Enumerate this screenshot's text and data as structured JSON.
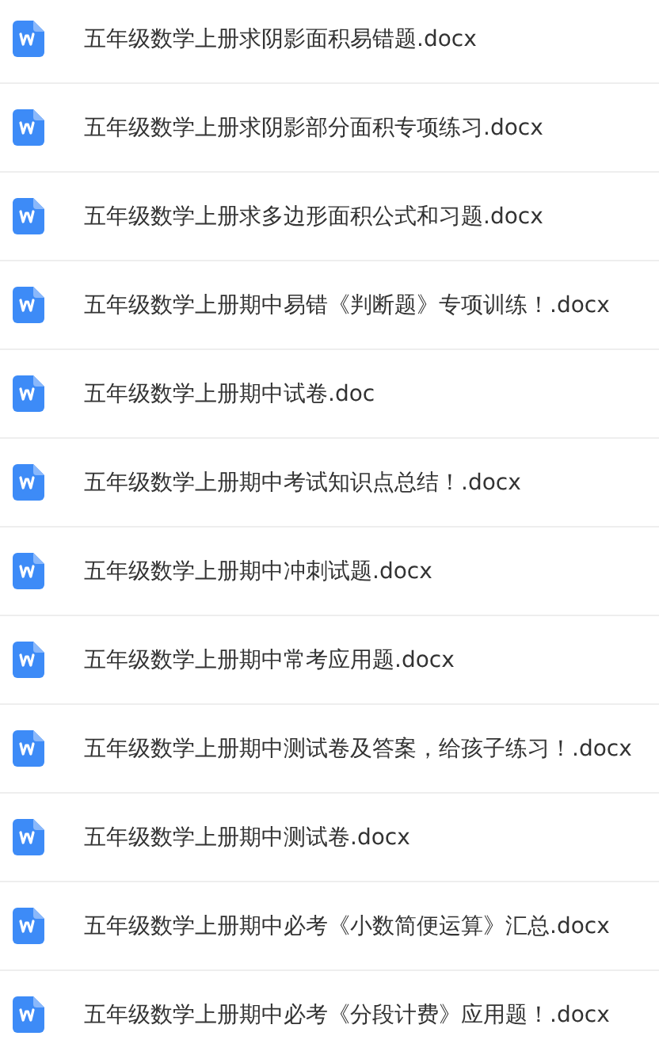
{
  "files": [
    {
      "name": "五年级数学上册求阴影面积易错题.docx",
      "kind": "word"
    },
    {
      "name": "五年级数学上册求阴影部分面积专项练习.docx",
      "kind": "word"
    },
    {
      "name": "五年级数学上册求多边形面积公式和习题.docx",
      "kind": "word"
    },
    {
      "name": "五年级数学上册期中易错《判断题》专项训练！.docx",
      "kind": "word"
    },
    {
      "name": "五年级数学上册期中试卷.doc",
      "kind": "word"
    },
    {
      "name": "五年级数学上册期中考试知识点总结！.docx",
      "kind": "word"
    },
    {
      "name": "五年级数学上册期中冲刺试题.docx",
      "kind": "word"
    },
    {
      "name": "五年级数学上册期中常考应用题.docx",
      "kind": "word"
    },
    {
      "name": "五年级数学上册期中测试卷及答案，给孩子练习！.docx",
      "kind": "word"
    },
    {
      "name": "五年级数学上册期中测试卷.docx",
      "kind": "word"
    },
    {
      "name": "五年级数学上册期中必考《小数简便运算》汇总.docx",
      "kind": "word"
    },
    {
      "name": "五年级数学上册期中必考《分段计费》应用题！.docx",
      "kind": "word"
    }
  ]
}
